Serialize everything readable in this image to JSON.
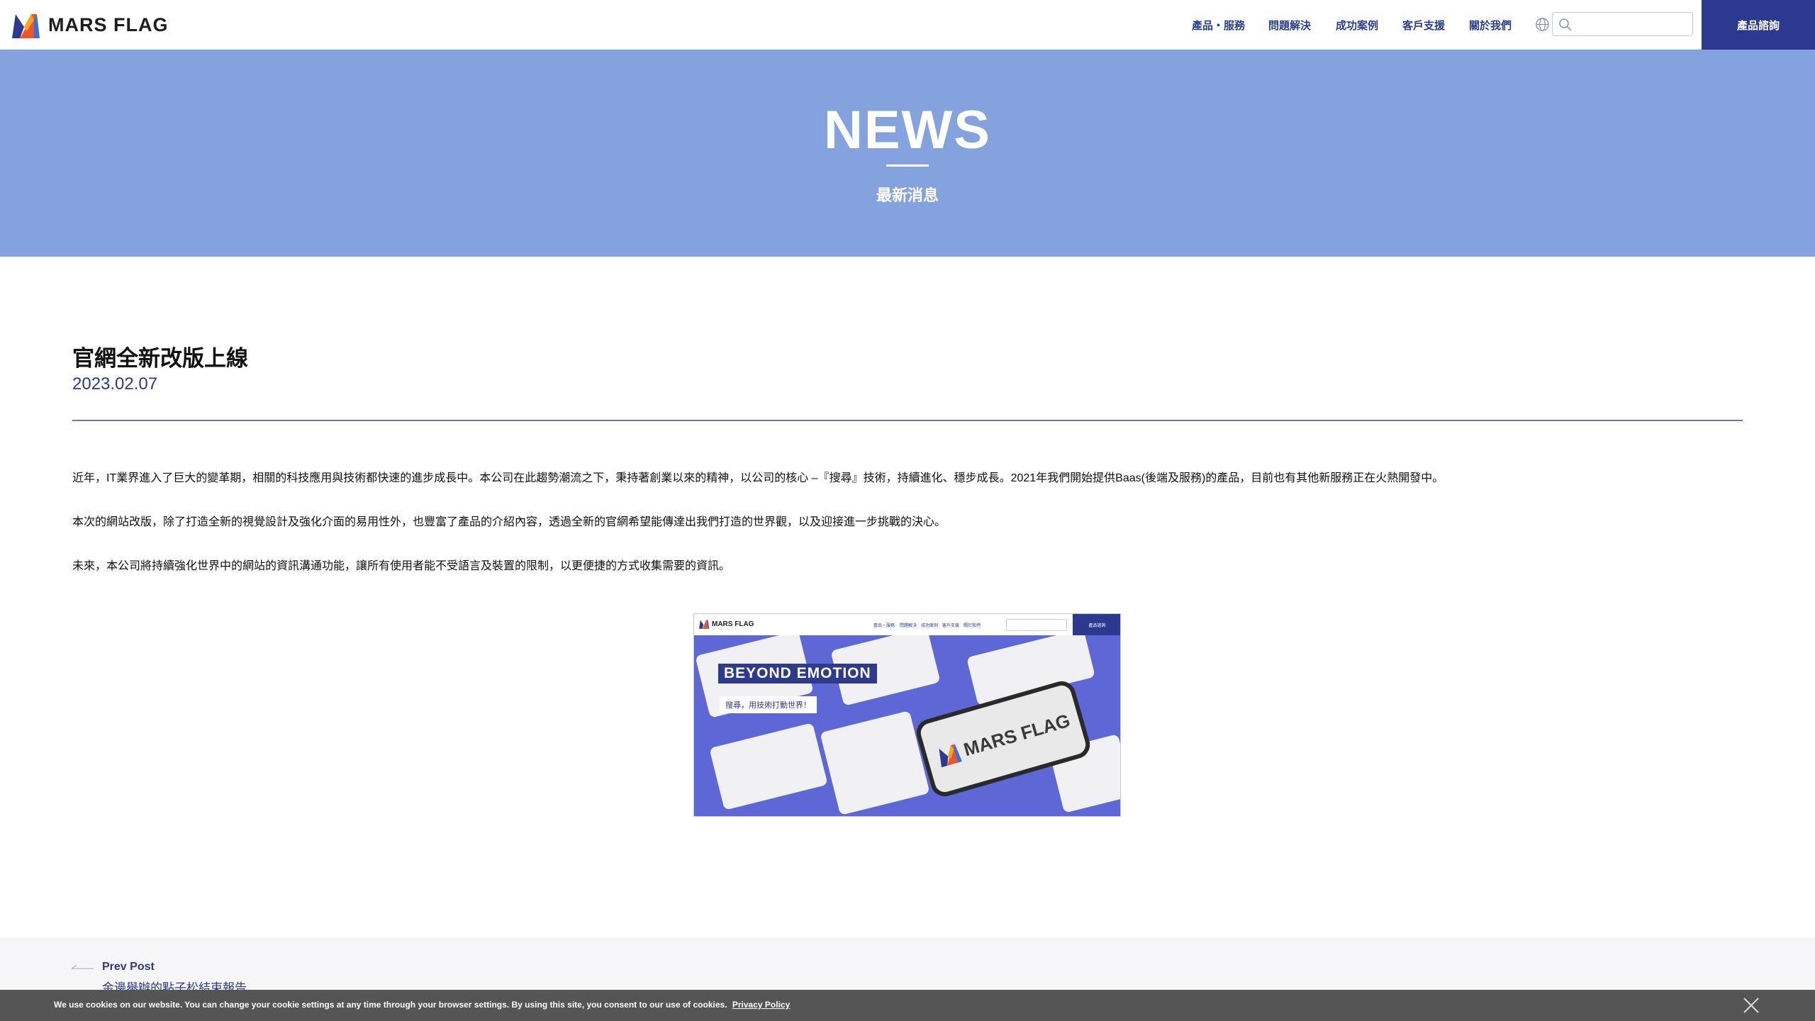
{
  "header": {
    "logo_text": "MARS FLAG",
    "nav": [
      "產品・服務",
      "問題解決",
      "成功案例",
      "客戶支援",
      "關於我們"
    ],
    "search_placeholder": "",
    "cta_label": "產品諮詢",
    "colors": {
      "nav": "#2b3f8e",
      "cta_bg": "#2b3a8f"
    }
  },
  "hero": {
    "title": "NEWS",
    "subtitle": "最新消息",
    "bg_color": "#84a2de"
  },
  "article": {
    "title": "官網全新改版上線",
    "date": "2023.02.07",
    "paragraphs": [
      "近年，IT業界進入了巨大的變革期，相關的科技應用與技術都快速的進步成長中。本公司在此趨勢潮流之下，秉持著創業以來的精神，以公司的核心 –『搜尋』技術，持續進化、穩步成長。2021年我們開始提供Baas(後端及服務)的產品，目前也有其他新服務正在火熱開發中。",
      "本次的網站改版，除了打造全新的視覺設計及強化介面的易用性外，也豐富了產品的介紹內容，透過全新的官網希望能傳達出我們打造的世界觀，以及迎接進一步挑戰的決心。",
      "未來，本公司將持續強化世界中的網站的資訊溝通功能，讓所有使用者能不受語言及裝置的限制，以更便捷的方式收集需要的資訊。"
    ],
    "image": {
      "logo_text": "MARS FLAG",
      "nav": [
        "產品・服務",
        "問題解決",
        "成功案例",
        "客戶支援",
        "關於我們"
      ],
      "cta_label": "產品諮詢",
      "banner": "BEYOND  EMOTION",
      "tagline": "搜尋，用技術打動世界！",
      "phone_text": "MARS FLAG"
    }
  },
  "post_nav": {
    "prev_label": "Prev Post",
    "prev_title": "金邊舉辦的點子松結束報告"
  },
  "cookie": {
    "text": "We use cookies on our website. You can change your cookie settings at any time through your browser settings. By using this site, you consent to our use of cookies.",
    "link": "Privacy Policy"
  }
}
